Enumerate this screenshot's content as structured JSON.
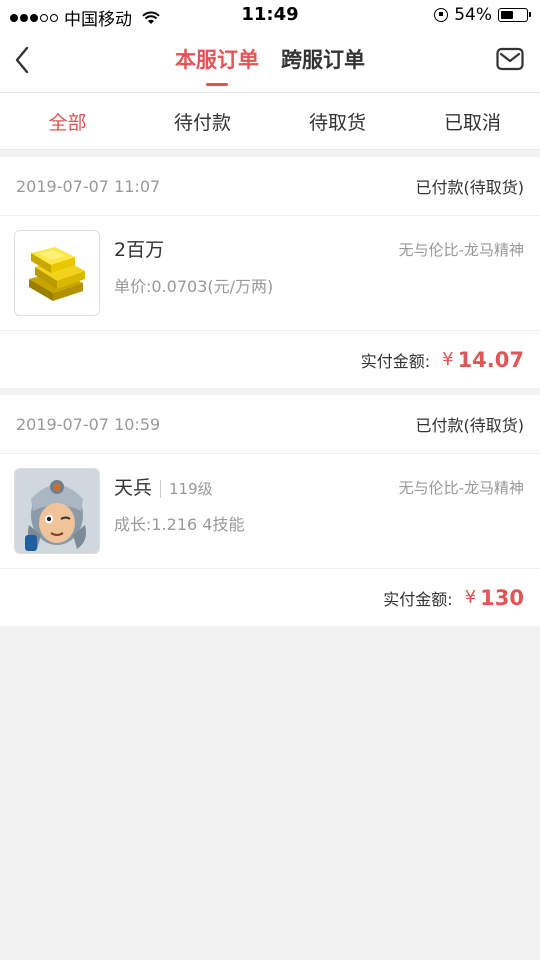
{
  "status_bar": {
    "carrier": "中国移动",
    "time": "11:49",
    "battery_percent": "54%",
    "battery_level": 0.54
  },
  "nav": {
    "tabs": [
      {
        "label": "本服订单",
        "active": true
      },
      {
        "label": "跨服订单",
        "active": false
      }
    ],
    "back_icon": "chevron-left-icon",
    "mail_icon": "mail-icon"
  },
  "filters": [
    {
      "label": "全部",
      "active": true
    },
    {
      "label": "待付款",
      "active": false
    },
    {
      "label": "待取货",
      "active": false
    },
    {
      "label": "已取消",
      "active": false
    }
  ],
  "orders": [
    {
      "time": "2019-07-07 11:07",
      "status": "已付款(待取货)",
      "item_name": "2百万",
      "item_level": "",
      "server": "无与伦比-龙马精神",
      "detail": "单价:0.0703(元/万两)",
      "pay_label": "实付金额:",
      "currency": "¥",
      "amount": "14.07",
      "thumb_icon": "gold-bars-icon"
    },
    {
      "time": "2019-07-07 10:59",
      "status": "已付款(待取货)",
      "item_name": "天兵",
      "item_level": "119级",
      "server": "无与伦比-龙马精神",
      "detail": "成长:1.216 4技能",
      "pay_label": "实付金额:",
      "currency": "¥",
      "amount": "130",
      "thumb_icon": "warrior-avatar-icon"
    }
  ],
  "colors": {
    "accent": "#e35456",
    "background": "#f2f2f2"
  }
}
